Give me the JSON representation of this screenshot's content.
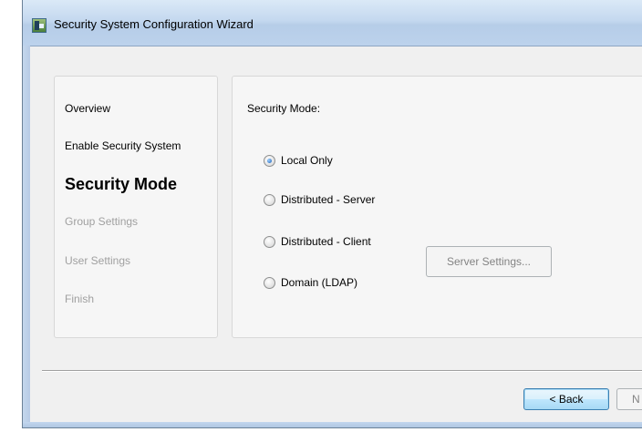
{
  "window": {
    "title": "Security System Configuration Wizard"
  },
  "nav": {
    "items": [
      {
        "label": "Overview",
        "state": "done"
      },
      {
        "label": "Enable Security System",
        "state": "done"
      },
      {
        "label": "Security Mode",
        "state": "current"
      },
      {
        "label": "Group Settings",
        "state": "disabled"
      },
      {
        "label": "User Settings",
        "state": "disabled"
      },
      {
        "label": "Finish",
        "state": "disabled"
      }
    ]
  },
  "content": {
    "section_label": "Security Mode:",
    "options": [
      {
        "label": "Local Only",
        "checked": true
      },
      {
        "label": "Distributed - Server",
        "checked": false
      },
      {
        "label": "Distributed - Client",
        "checked": false
      },
      {
        "label": "Domain (LDAP)",
        "checked": false
      }
    ],
    "server_settings_label": "Server Settings..."
  },
  "footer": {
    "back_label": "< Back",
    "next_label": "N"
  }
}
